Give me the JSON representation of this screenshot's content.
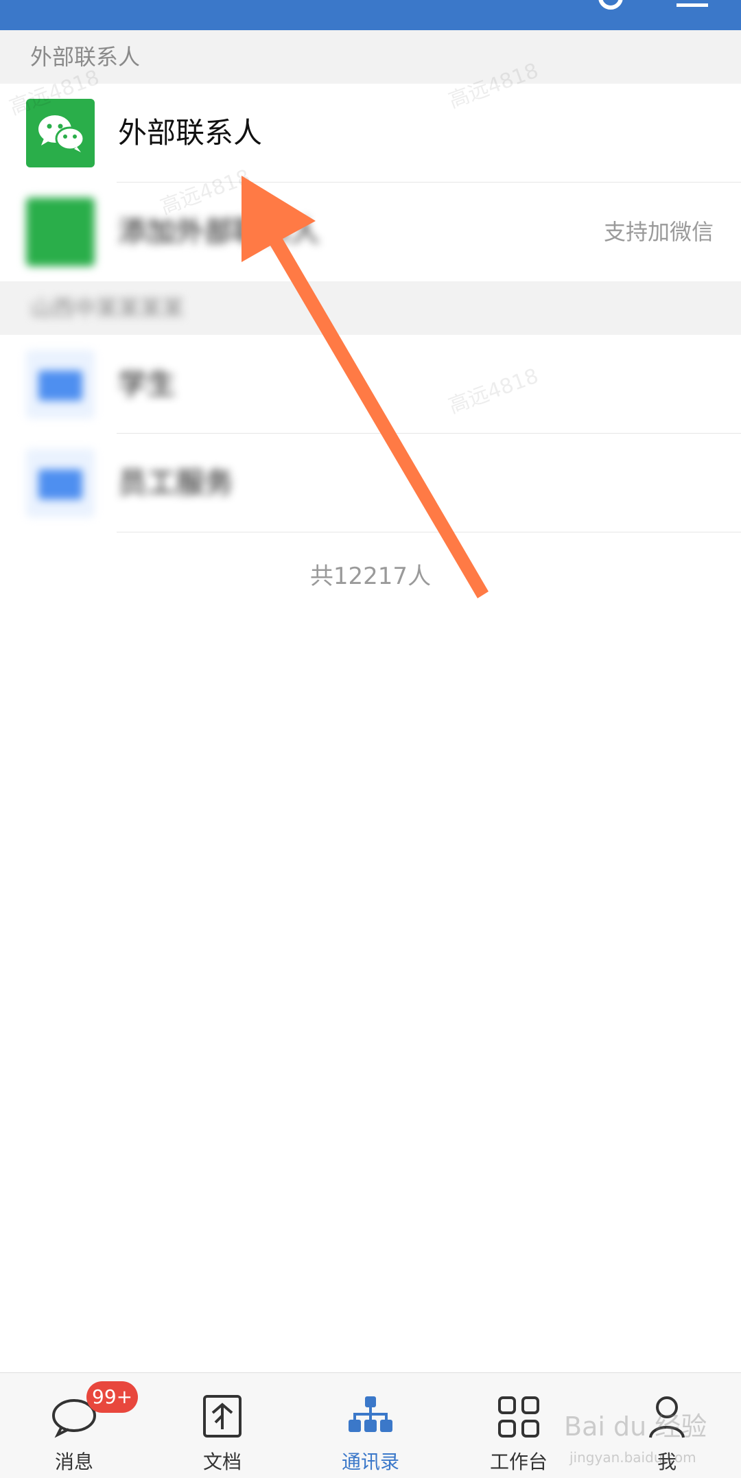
{
  "header": {
    "title": "",
    "search_icon": "search-icon",
    "menu_icon": "menu-icon"
  },
  "external_section": {
    "header": "外部联系人",
    "items": [
      {
        "label": "外部联系人",
        "icon": "wechat-icon"
      },
      {
        "label": "添加外部联系人",
        "right_text": "支持加微信",
        "icon": "add-contact-icon"
      }
    ]
  },
  "org_section": {
    "header": "山西中某某某某",
    "items": [
      {
        "label": "学生",
        "icon": "folder-icon"
      },
      {
        "label": "员工服务",
        "icon": "folder-icon"
      }
    ]
  },
  "total": "共12217人",
  "watermark_text": "高远4818",
  "tabs": [
    {
      "label": "消息",
      "icon": "chat-bubble-icon",
      "badge": "99+"
    },
    {
      "label": "文档",
      "icon": "document-icon"
    },
    {
      "label": "通讯录",
      "icon": "org-chart-icon",
      "active": true
    },
    {
      "label": "工作台",
      "icon": "grid-icon"
    },
    {
      "label": "我",
      "icon": "person-icon"
    }
  ],
  "brand_watermark": "Bai du 经验",
  "brand_watermark_sub": "jingyan.baidu.com",
  "colors": {
    "header_blue": "#3b78c9",
    "wechat_green": "#2aae4a",
    "arrow_orange": "#ff7a45",
    "badge_red": "#e8473d",
    "folder_blue": "#4e8ff0"
  }
}
